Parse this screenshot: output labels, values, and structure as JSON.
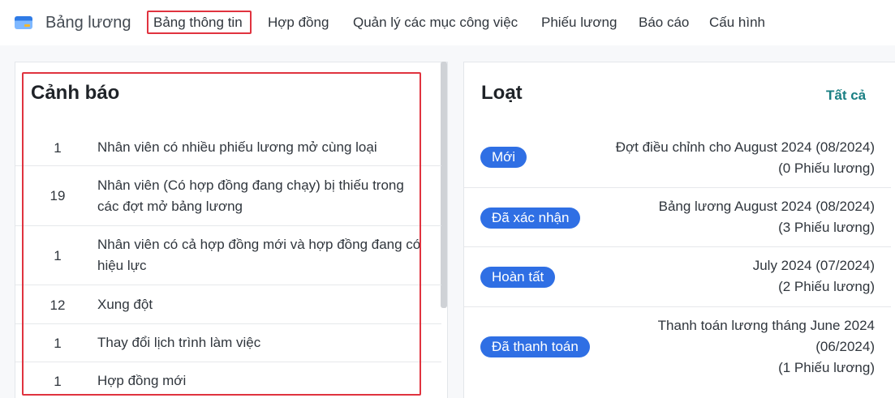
{
  "app": {
    "title": "Bảng lương"
  },
  "nav": {
    "items": [
      {
        "label": "Bảng thông tin",
        "active": true
      },
      {
        "label": "Hợp đồng"
      },
      {
        "label": "Quản lý các mục công việc"
      },
      {
        "label": "Phiếu lương"
      },
      {
        "label": "Báo cáo"
      },
      {
        "label": "Cấu hình"
      }
    ]
  },
  "warnings": {
    "title": "Cảnh báo",
    "items": [
      {
        "count": "1",
        "text": "Nhân viên có nhiều phiếu lương mở cùng loại"
      },
      {
        "count": "19",
        "text": "Nhân viên (Có hợp đồng đang chạy) bị thiếu trong các đợt mở bảng lương"
      },
      {
        "count": "1",
        "text": "Nhân viên có cả hợp đồng mới và hợp đồng đang có hiệu lực"
      },
      {
        "count": "12",
        "text": "Xung đột"
      },
      {
        "count": "1",
        "text": "Thay đổi lịch trình làm việc"
      },
      {
        "count": "1",
        "text": "Hợp đồng mới"
      }
    ]
  },
  "batches": {
    "title": "Loạt",
    "see_all": "Tất cả",
    "items": [
      {
        "status": "Mới",
        "name": "Đợt điều chỉnh cho August 2024 (08/2024)",
        "payslips": "(0 Phiếu lương)"
      },
      {
        "status": "Đã xác nhận",
        "name": "Bảng lương August 2024 (08/2024)",
        "payslips": "(3 Phiếu lương)"
      },
      {
        "status": "Hoàn tất",
        "name": "July 2024 (07/2024)",
        "payslips": "(2 Phiếu lương)"
      },
      {
        "status": "Đã thanh toán",
        "name": "Thanh toán lương tháng June 2024 (06/2024)",
        "payslips": "(1 Phiếu lương)"
      }
    ]
  },
  "colors": {
    "accent": "#2f6fe4",
    "highlight": "#e0333f",
    "link": "#1a7f83"
  }
}
